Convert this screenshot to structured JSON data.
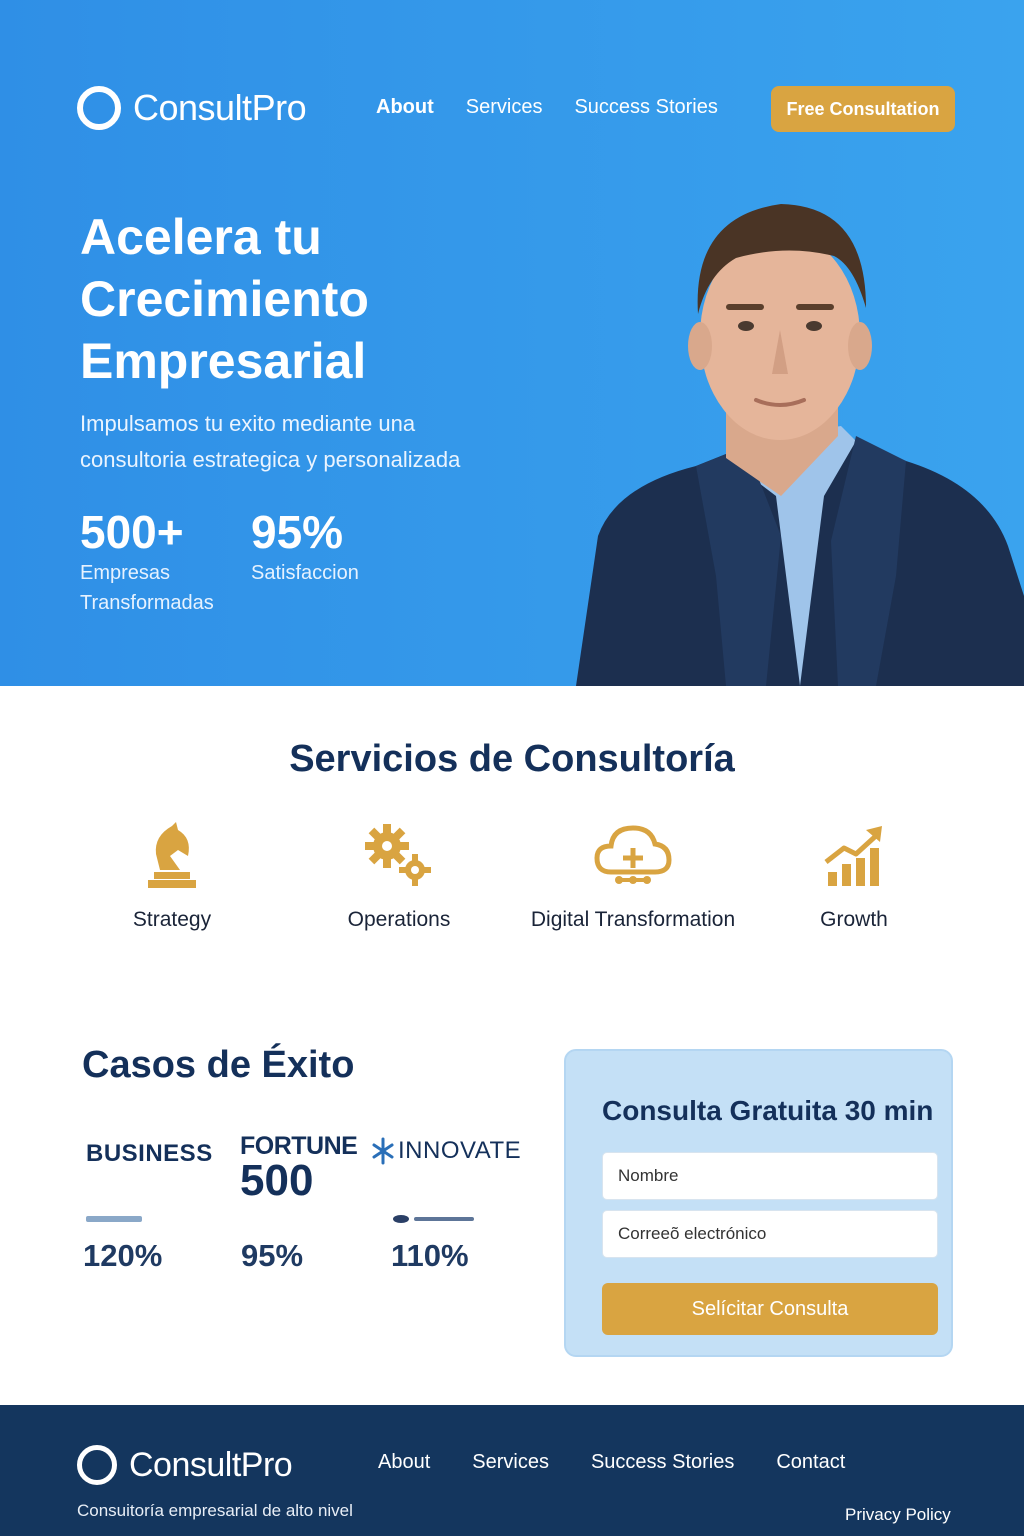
{
  "brand": {
    "name": "ConsultPro"
  },
  "header": {
    "nav": [
      {
        "label": "About"
      },
      {
        "label": "Services"
      },
      {
        "label": "Success Stories"
      }
    ],
    "cta_label": "Free Consultation"
  },
  "hero": {
    "title": "Acelera tu Crecimiento Empresarial",
    "subtitle": "Impulsamos tu exito mediante una consultoria estrategica y personalizada",
    "stats": [
      {
        "value": "500+",
        "label": "Empresas Transformadas"
      },
      {
        "value": "95%",
        "label": "Satisfaccion"
      }
    ]
  },
  "services": {
    "title": "Servicios de Consultoría",
    "items": [
      {
        "label": "Strategy",
        "icon": "chess-knight-icon"
      },
      {
        "label": "Operations",
        "icon": "gears-icon"
      },
      {
        "label": "Digital Transformation",
        "icon": "cloud-icon"
      },
      {
        "label": "Growth",
        "icon": "growth-chart-icon"
      }
    ]
  },
  "cases": {
    "title": "Casos de Éxito",
    "brands": [
      {
        "name": "BUSINESS",
        "result": "120%"
      },
      {
        "name_line1": "FORTUNE",
        "name_line2": "500",
        "result": "95%"
      },
      {
        "name": "INNOVATE",
        "result": "110%"
      }
    ]
  },
  "form": {
    "title": "Consulta Gratuita 30 min",
    "name_placeholder": "Nombre",
    "email_placeholder": "Correeõ electrónico",
    "submit_label": "Selícitar Consulta"
  },
  "footer": {
    "tagline": "Consuitoría empresarial de alto nivel",
    "nav": [
      {
        "label": "About"
      },
      {
        "label": "Services"
      },
      {
        "label": "Success Stories"
      },
      {
        "label": "Contact"
      }
    ],
    "privacy_label": "Privacy Policy"
  },
  "colors": {
    "hero_blue": "#2f8fe6",
    "accent_gold": "#d9a441",
    "navy": "#14365e",
    "form_bg": "#c4e0f6"
  }
}
